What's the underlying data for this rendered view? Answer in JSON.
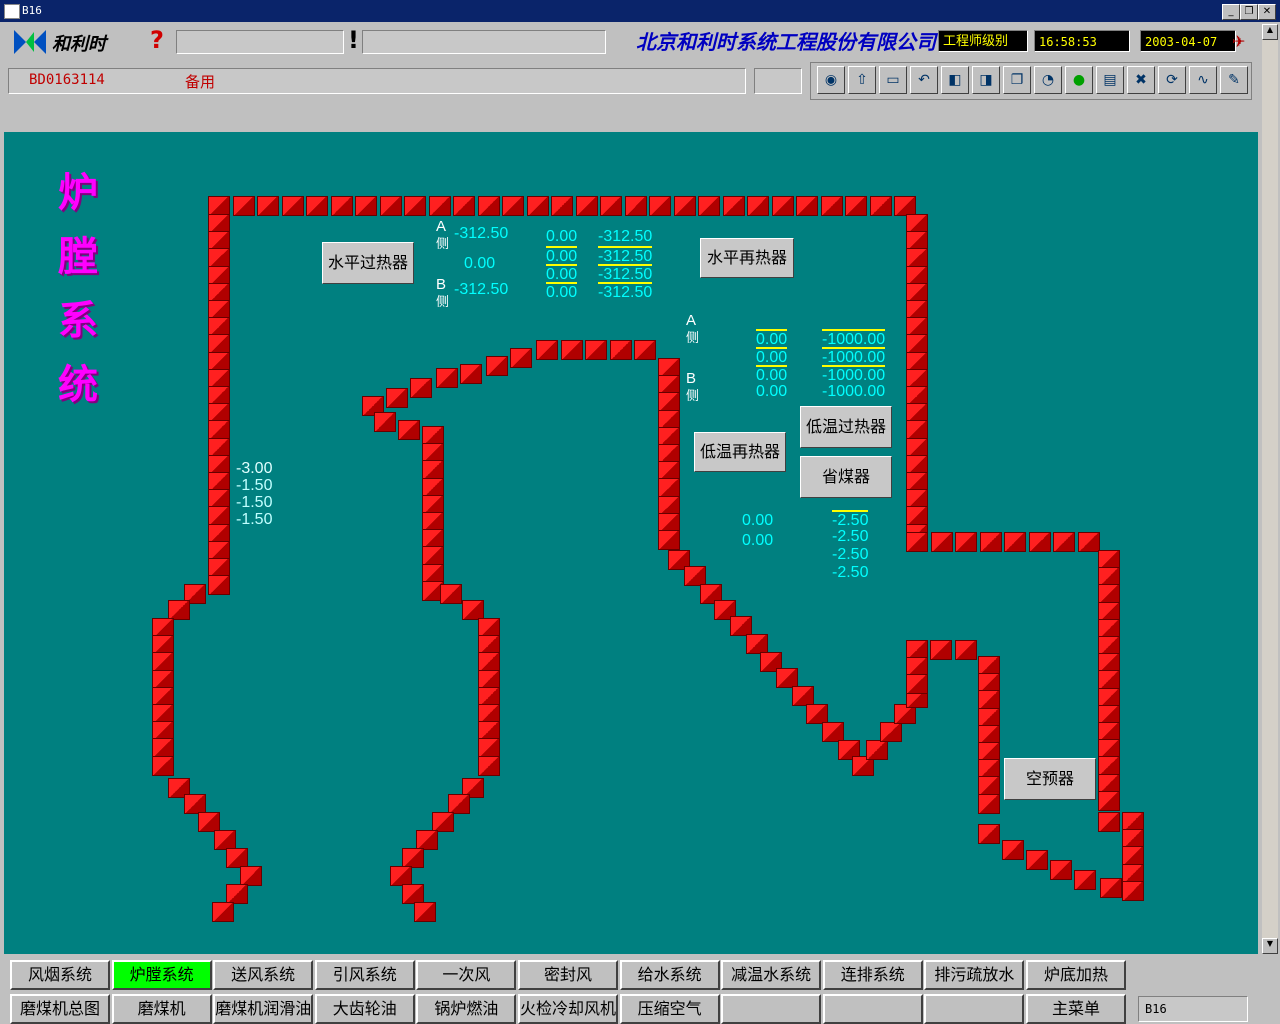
{
  "window": {
    "title": "B16"
  },
  "header": {
    "help_glyph": "?",
    "alert_glyph": "!",
    "company": "北京和利时系统工程股份有限公司",
    "user_level": "工程师级别",
    "time": "16:58:53",
    "date": "2003-04-07",
    "point_id": "BD0163114",
    "point_desc": "备用"
  },
  "toolbar_icons": [
    "record-icon",
    "upload-icon",
    "link-icon",
    "return-icon",
    "page-left-icon",
    "page-right-icon",
    "copy-icon",
    "alarm-clock-icon",
    "status-light-icon",
    "report-icon",
    "alarm-delete-icon",
    "refresh-icon",
    "trend-icon",
    "notes-icon"
  ],
  "page": {
    "title_chars": [
      "炉",
      "膛",
      "系",
      "统"
    ],
    "labels": {
      "h_superheater": "水平过热器",
      "h_reheater": "水平再热器",
      "lt_superheater": "低温过热器",
      "lt_reheater": "低温再热器",
      "economizer": "省煤器",
      "air_preheater": "空预器"
    },
    "side_a": "A",
    "side_b": "B",
    "side_char": "侧",
    "values": {
      "hs_a": "-312.50",
      "hs_mid": "0.00",
      "hs_b": "-312.50",
      "col2": [
        "0.00",
        "0.00",
        "0.00",
        "0.00"
      ],
      "col3": [
        "-312.50",
        "-312.50",
        "-312.50",
        "-312.50"
      ],
      "rh_col1": [
        "0.00",
        "0.00",
        "0.00",
        "0.00"
      ],
      "rh_col2": [
        "-1000.00",
        "-1000.00",
        "-1000.00",
        "-1000.00"
      ],
      "furnace": [
        "-3.00",
        "-1.50",
        "-1.50",
        "-1.50"
      ],
      "eco_left": [
        "0.00",
        "0.00"
      ],
      "eco_right": [
        "-2.50",
        "-2.50",
        "-2.50",
        "-2.50"
      ]
    }
  },
  "nav_row1": [
    "风烟系统",
    "炉膛系统",
    "送风系统",
    "引风系统",
    "一次风",
    "密封风",
    "给水系统",
    "减温水系统",
    "连排系统",
    "排污疏放水",
    "炉底加热"
  ],
  "nav_row2": [
    "磨煤机总图",
    "磨煤机",
    "磨煤机润滑油",
    "大齿轮油",
    "锅炉燃油",
    "火检冷却风机",
    "压缩空气",
    "",
    "",
    "",
    "主菜单"
  ],
  "status_right": "B16",
  "colors": {
    "background": "#008080",
    "active_nav": "#00ff00",
    "wall": "#ff2020",
    "value": "#00ffff",
    "title": "#ff00ff"
  }
}
